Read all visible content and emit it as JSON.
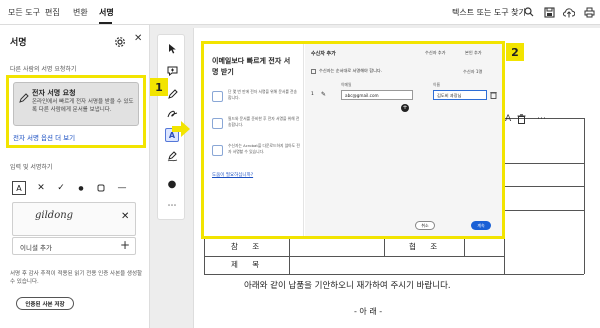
{
  "topbar": {
    "menu": [
      {
        "label": "모든 도구"
      },
      {
        "label": "편집"
      },
      {
        "label": "변환"
      },
      {
        "label": "서명"
      }
    ],
    "search_label": "텍스트 또는 도구 찾기"
  },
  "left_panel": {
    "title": "서명",
    "request_section_label": "다른 사람의 서명 요청하기",
    "request_card": {
      "title": "전자 서명 요청",
      "description": "온라인에서 빠르게 전자 서명을 받을 수 있도록 다른 사람에게 문서를 보냅니다."
    },
    "more_options_link": "전자 서명 옵션 더 보기",
    "self_section_label": "입력 및 서명하기",
    "signature_text": "gildong",
    "initial_label": "이니셜 추가",
    "note": "서명 후 감사 추적이 적용된 읽기 전용 인증 사본을 생성할 수 있습니다.",
    "save_copy_button": "인증된 사본 저장"
  },
  "dialog": {
    "left_title": "이메일보다 빠르게 전자 서명 받기",
    "features": [
      {
        "text": "단 몇 번 만에 전자 서명을 위해 문서를 전송합니다."
      },
      {
        "text": "필드와 문서를 준비한 후 전자 서명을 위해 전송합니다."
      },
      {
        "text": "수신자는 Acrobat을 다운로드하지 않아도 전자 서명할 수 있습니다."
      }
    ],
    "help_link": "도움이 필요하십니까?",
    "right_header": "수신자 추가",
    "header_link_1": "수신자 추가",
    "header_link_2": "본인 추가",
    "option_text": "수신자는 순서대로 서명해야 합니다.",
    "order_label": "수신자 1명",
    "email_label": "이메일",
    "email_value": "abc@gmail.com",
    "name_label": "이름",
    "name_value": "김도비 과장님",
    "recipient_number": "1",
    "cancel_button": "취소",
    "send_button": "계속"
  },
  "document": {
    "row_label_1": "참 조",
    "row_label_2": "협 조",
    "row_label_3": "제 목",
    "body_text": "아래와 같이 납품을 기안하오니 재가하여 주시기 바랍니다.",
    "footer_text": "- 아   래 -"
  },
  "callouts": {
    "one": "1",
    "two": "2"
  },
  "colors": {
    "highlight": "#f2e400",
    "link": "#1a4fc2",
    "primary_button": "#1a60d6"
  }
}
